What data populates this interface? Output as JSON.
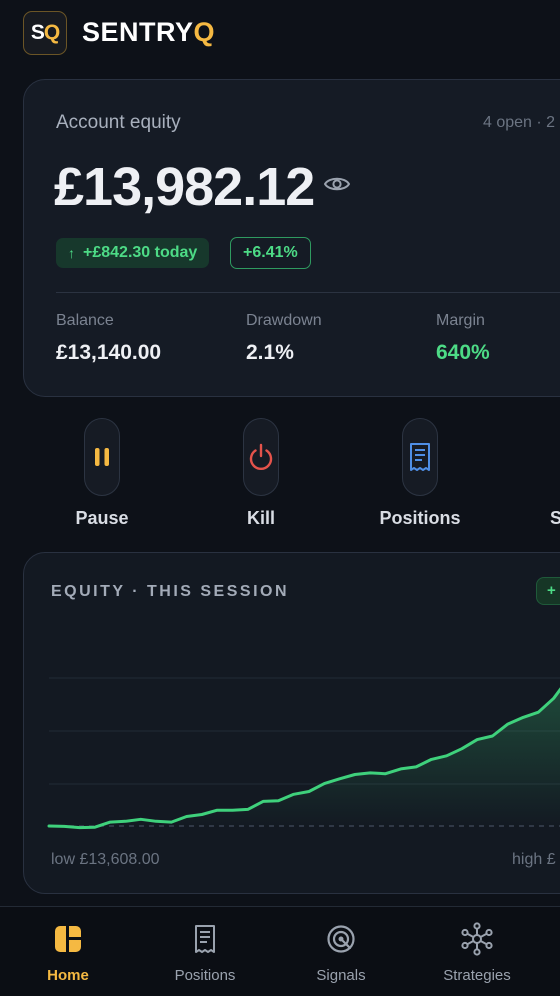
{
  "header": {
    "logo_s": "S",
    "logo_q": "Q",
    "brand_main": "SENTRY",
    "brand_accent": "Q"
  },
  "equity": {
    "label": "Account equity",
    "meta": "4 open · 2",
    "value": "£13,982.12",
    "today_arrow": "↑",
    "today_change": "+£842.30 today",
    "pct_change": "+6.41%",
    "stats": [
      {
        "label": "Balance",
        "value": "£13,140.00"
      },
      {
        "label": "Drawdown",
        "value": "2.1%"
      },
      {
        "label": "Margin",
        "value": "640%"
      }
    ]
  },
  "actions": [
    {
      "label": "Pause",
      "icon": "pause-icon"
    },
    {
      "label": "Kill",
      "icon": "power-icon"
    },
    {
      "label": "Positions",
      "icon": "receipt-icon"
    },
    {
      "label": "S",
      "icon": "strategies-icon"
    }
  ],
  "chart_panel": {
    "title": "EQUITY  ·  THIS SESSION",
    "badge": "+",
    "low_label": "low £13,608.00",
    "high_label": "high £"
  },
  "chart_data": {
    "type": "area",
    "title": "EQUITY · THIS SESSION",
    "xlabel": "",
    "ylabel": "",
    "grid": true,
    "baseline": 13608,
    "ylim": [
      13540,
      14120
    ],
    "values": [
      13608,
      13607,
      13604,
      13605,
      13618,
      13620,
      13625,
      13620,
      13618,
      13632,
      13637,
      13648,
      13648,
      13650,
      13670,
      13672,
      13688,
      13695,
      13715,
      13727,
      13738,
      13742,
      13740,
      13752,
      13757,
      13776,
      13785,
      13803,
      13826,
      13835,
      13865,
      13882,
      13895,
      13930,
      13982
    ],
    "colors": {
      "line": "#3fd17c",
      "baseline": "#3a4352"
    }
  },
  "nav": [
    {
      "label": "Home",
      "icon": "home-icon",
      "active": true
    },
    {
      "label": "Positions",
      "icon": "receipt-icon",
      "active": false
    },
    {
      "label": "Signals",
      "icon": "target-icon",
      "active": false
    },
    {
      "label": "Strategies",
      "icon": "network-icon",
      "active": false
    }
  ],
  "colors": {
    "accent": "#f5b942",
    "positive": "#4ddb86",
    "danger": "#e5534b",
    "info": "#4f8fe6",
    "background": "#0d1118"
  }
}
